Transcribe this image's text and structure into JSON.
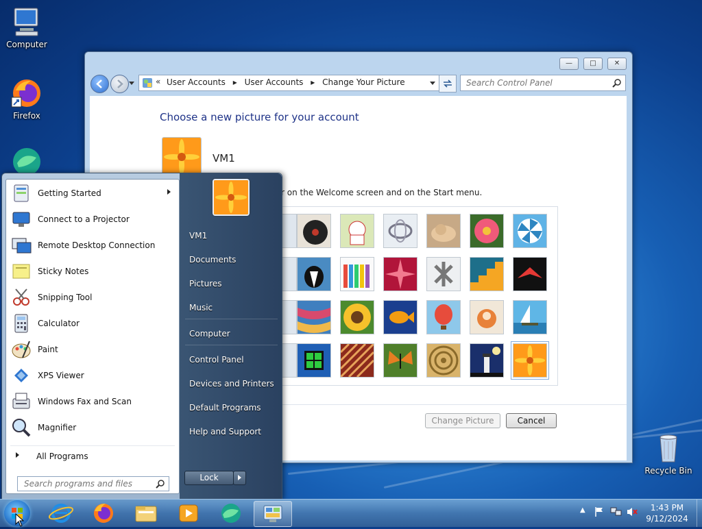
{
  "desktop": {
    "icons": [
      {
        "label": "Computer",
        "icon": "computer-icon"
      },
      {
        "label": "Firefox",
        "icon": "firefox-icon"
      },
      {
        "label": "",
        "icon": "browser-icon"
      },
      {
        "label": "Recycle Bin",
        "icon": "recycle-bin-icon"
      }
    ]
  },
  "window": {
    "address": {
      "crumbs": [
        "User Accounts",
        "User Accounts",
        "Change Your Picture"
      ]
    },
    "search_placeholder": "Search Control Panel",
    "heading": "Choose a new picture for your account",
    "username": "VM1",
    "description_fragment": "r on the Welcome screen and on the Start menu.",
    "pictures": [
      "record-player",
      "lucky-cat",
      "gyroscope",
      "kitten",
      "pink-flower",
      "pinwheel",
      "dog",
      "crayons",
      "starburst",
      "jacks",
      "stairs",
      "paper-crane",
      "fabric",
      "sunflower",
      "fish",
      "hot-air-balloon",
      "doll",
      "sailboat",
      "window-frame",
      "pattern",
      "butterfly",
      "basket",
      "lighthouse",
      "orange-flower"
    ],
    "selected_picture": "orange-flower",
    "buttons": {
      "change": "Change Picture",
      "cancel": "Cancel"
    }
  },
  "start_menu": {
    "programs": [
      {
        "label": "Getting Started",
        "icon": "getting-started-icon",
        "submenu": true
      },
      {
        "label": "Connect to a Projector",
        "icon": "projector-icon",
        "submenu": false
      },
      {
        "label": "Remote Desktop Connection",
        "icon": "remote-desktop-icon",
        "submenu": false
      },
      {
        "label": "Sticky Notes",
        "icon": "sticky-notes-icon",
        "submenu": false
      },
      {
        "label": "Snipping Tool",
        "icon": "snipping-tool-icon",
        "submenu": false
      },
      {
        "label": "Calculator",
        "icon": "calculator-icon",
        "submenu": false
      },
      {
        "label": "Paint",
        "icon": "paint-icon",
        "submenu": false
      },
      {
        "label": "XPS Viewer",
        "icon": "xps-viewer-icon",
        "submenu": false
      },
      {
        "label": "Windows Fax and Scan",
        "icon": "fax-scan-icon",
        "submenu": false
      },
      {
        "label": "Magnifier",
        "icon": "magnifier-icon",
        "submenu": false
      }
    ],
    "all_programs": "All Programs",
    "search_placeholder": "Search programs and files",
    "right_links": [
      "VM1",
      "Documents",
      "Pictures",
      "Music",
      "Computer",
      "Control Panel",
      "Devices and Printers",
      "Default Programs",
      "Help and Support"
    ],
    "lock_label": "Lock"
  },
  "taskbar": {
    "items": [
      "start-orb",
      "internet-explorer-icon",
      "firefox-icon",
      "file-explorer-icon",
      "media-player-icon",
      "browser-icon",
      "control-panel-icon"
    ],
    "clock": {
      "time": "1:43 PM",
      "date": "9/12/2024"
    }
  }
}
